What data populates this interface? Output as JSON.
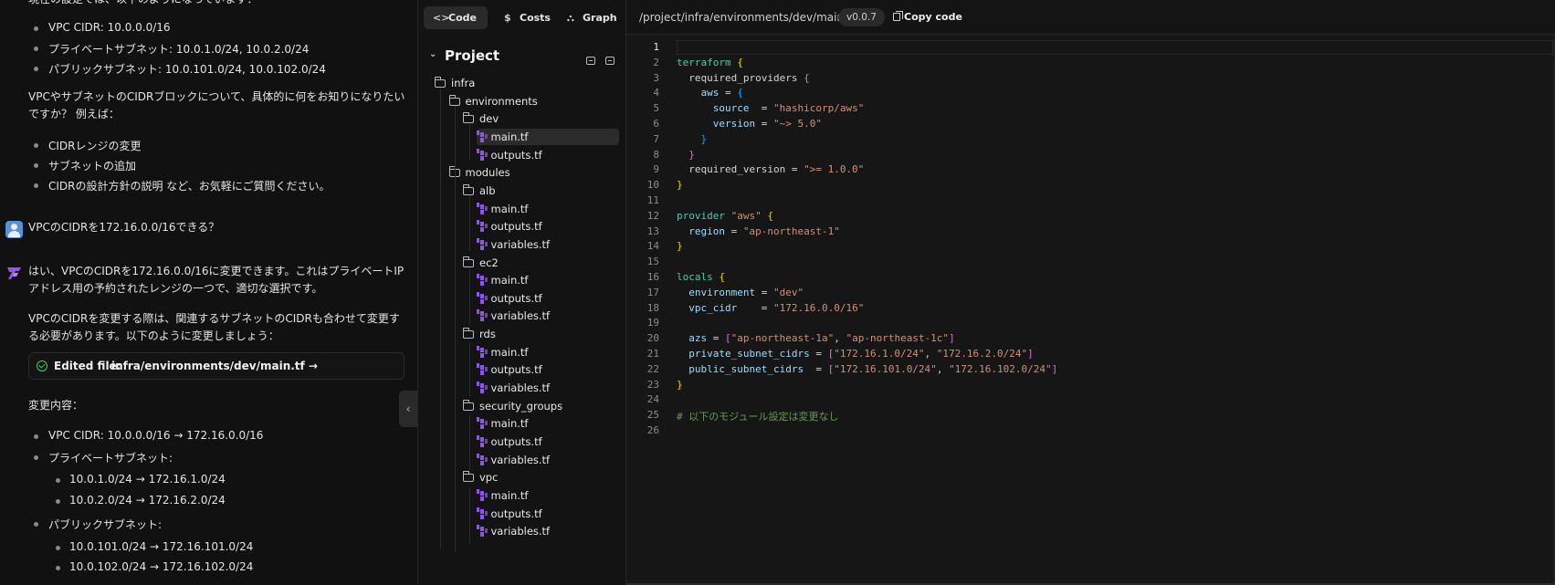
{
  "chat": {
    "top_cut_text": "現在の設定では、以下のようになっています：",
    "current": [
      "VPC CIDR: 10.0.0.0/16",
      "プライベートサブネット: 10.0.1.0/24, 10.0.2.0/24",
      "パブリックサブネット: 10.0.101.0/24, 10.0.102.0/24"
    ],
    "question": "VPCやサブネットのCIDRブロックについて、具体的に何をお知りになりたいですか？ 例えば：",
    "options": [
      "CIDRレンジの変更",
      "サブネットの追加",
      "CIDRの設計方針の説明 など、お気軽にご質問ください。"
    ],
    "user_message": "VPCのCIDRを172.16.0.0/16できる？",
    "ai_reply_1": "はい、VPCのCIDRを172.16.0.0/16に変更できます。これはプライベートIPアドレス用の予約されたレンジの一つで、適切な選択です。",
    "ai_reply_2": "VPCのCIDRを変更する際は、関連するサブネットのCIDRも合わせて変更する必要があります。以下のように変更しましょう：",
    "edited_label": "Edited file:",
    "edited_path": "infra/environments/dev/main.tf →",
    "changes_title": "変更内容：",
    "change_vpc": "VPC CIDR: 10.0.0.0/16 → 172.16.0.0/16",
    "change_private_title": "プライベートサブネット:",
    "change_private": [
      "10.0.1.0/24 → 172.16.1.0/24",
      "10.0.2.0/24 → 172.16.2.0/24"
    ],
    "change_public_title": "パブリックサブネット:",
    "change_public": [
      "10.0.101.0/24 → 172.16.101.0/24",
      "10.0.102.0/24 → 172.16.102.0/24"
    ],
    "collapse_glyph": "‹"
  },
  "toolbar": {
    "code_label": "Code",
    "costs_label": "Costs",
    "graph_label": "Graph",
    "code_icon": "<>",
    "costs_icon": "$",
    "graph_icon": "⛬"
  },
  "project": {
    "title": "Project",
    "chevron": "⌄",
    "tree": [
      {
        "label": "infra",
        "type": "folder",
        "depth": 0
      },
      {
        "label": "environments",
        "type": "folder",
        "depth": 1
      },
      {
        "label": "dev",
        "type": "folder",
        "depth": 2
      },
      {
        "label": "main.tf",
        "type": "file",
        "depth": 3,
        "selected": true
      },
      {
        "label": "outputs.tf",
        "type": "file",
        "depth": 3
      },
      {
        "label": "modules",
        "type": "folder",
        "depth": 1
      },
      {
        "label": "alb",
        "type": "folder",
        "depth": 2
      },
      {
        "label": "main.tf",
        "type": "file",
        "depth": 3
      },
      {
        "label": "outputs.tf",
        "type": "file",
        "depth": 3
      },
      {
        "label": "variables.tf",
        "type": "file",
        "depth": 3
      },
      {
        "label": "ec2",
        "type": "folder",
        "depth": 2
      },
      {
        "label": "main.tf",
        "type": "file",
        "depth": 3
      },
      {
        "label": "outputs.tf",
        "type": "file",
        "depth": 3
      },
      {
        "label": "variables.tf",
        "type": "file",
        "depth": 3
      },
      {
        "label": "rds",
        "type": "folder",
        "depth": 2
      },
      {
        "label": "main.tf",
        "type": "file",
        "depth": 3
      },
      {
        "label": "outputs.tf",
        "type": "file",
        "depth": 3
      },
      {
        "label": "variables.tf",
        "type": "file",
        "depth": 3
      },
      {
        "label": "security_groups",
        "type": "folder",
        "depth": 2
      },
      {
        "label": "main.tf",
        "type": "file",
        "depth": 3
      },
      {
        "label": "outputs.tf",
        "type": "file",
        "depth": 3
      },
      {
        "label": "variables.tf",
        "type": "file",
        "depth": 3
      },
      {
        "label": "vpc",
        "type": "folder",
        "depth": 2
      },
      {
        "label": "main.tf",
        "type": "file",
        "depth": 3
      },
      {
        "label": "outputs.tf",
        "type": "file",
        "depth": 3
      },
      {
        "label": "variables.tf",
        "type": "file",
        "depth": 3
      }
    ]
  },
  "editor": {
    "path": "/project/infra/environments/dev/main.tf",
    "version": "v0.0.7",
    "copy_label": "Copy code",
    "current_line": 1,
    "lines": [
      [],
      [
        [
          "k",
          "terraform"
        ],
        [
          "p",
          " "
        ],
        [
          "b1",
          "{"
        ]
      ],
      [
        [
          "p",
          "  required_providers "
        ],
        [
          "b2",
          "{"
        ]
      ],
      [
        [
          "p",
          "    "
        ],
        [
          "attr",
          "aws"
        ],
        [
          "p",
          " = "
        ],
        [
          "b3",
          "{"
        ]
      ],
      [
        [
          "p",
          "      "
        ],
        [
          "attr",
          "source"
        ],
        [
          "p",
          "  = "
        ],
        [
          "s",
          "\"hashicorp/aws\""
        ]
      ],
      [
        [
          "p",
          "      "
        ],
        [
          "attr",
          "version"
        ],
        [
          "p",
          " = "
        ],
        [
          "s",
          "\"~> 5.0\""
        ]
      ],
      [
        [
          "p",
          "    "
        ],
        [
          "b3",
          "}"
        ]
      ],
      [
        [
          "p",
          "  "
        ],
        [
          "b2",
          "}"
        ]
      ],
      [
        [
          "p",
          "  required_version = "
        ],
        [
          "s",
          "\">= 1.0.0\""
        ]
      ],
      [
        [
          "b1",
          "}"
        ]
      ],
      [],
      [
        [
          "k",
          "provider"
        ],
        [
          "p",
          " "
        ],
        [
          "s",
          "\"aws\""
        ],
        [
          "p",
          " "
        ],
        [
          "b1",
          "{"
        ]
      ],
      [
        [
          "p",
          "  "
        ],
        [
          "attr",
          "region"
        ],
        [
          "p",
          " = "
        ],
        [
          "s",
          "\"ap-northeast-1\""
        ]
      ],
      [
        [
          "b1",
          "}"
        ]
      ],
      [],
      [
        [
          "k",
          "locals"
        ],
        [
          "p",
          " "
        ],
        [
          "b1",
          "{"
        ]
      ],
      [
        [
          "p",
          "  "
        ],
        [
          "attr",
          "environment"
        ],
        [
          "p",
          " = "
        ],
        [
          "s",
          "\"dev\""
        ]
      ],
      [
        [
          "p",
          "  "
        ],
        [
          "attr",
          "vpc_cidr"
        ],
        [
          "p",
          "    = "
        ],
        [
          "s",
          "\"172.16.0.0/16\""
        ]
      ],
      [],
      [
        [
          "p",
          "  "
        ],
        [
          "attr",
          "azs"
        ],
        [
          "p",
          " = "
        ],
        [
          "b2",
          "["
        ],
        [
          "s",
          "\"ap-northeast-1a\""
        ],
        [
          "p",
          ", "
        ],
        [
          "s",
          "\"ap-northeast-1c\""
        ],
        [
          "b2",
          "]"
        ]
      ],
      [
        [
          "p",
          "  "
        ],
        [
          "attr",
          "private_subnet_cidrs"
        ],
        [
          "p",
          " = "
        ],
        [
          "b2",
          "["
        ],
        [
          "s",
          "\"172.16.1.0/24\""
        ],
        [
          "p",
          ", "
        ],
        [
          "s",
          "\"172.16.2.0/24\""
        ],
        [
          "b2",
          "]"
        ]
      ],
      [
        [
          "p",
          "  "
        ],
        [
          "attr",
          "public_subnet_cidrs"
        ],
        [
          "p",
          "  = "
        ],
        [
          "b2",
          "["
        ],
        [
          "s",
          "\"172.16.101.0/24\""
        ],
        [
          "p",
          ", "
        ],
        [
          "s",
          "\"172.16.102.0/24\""
        ],
        [
          "b2",
          "]"
        ]
      ],
      [
        [
          "b1",
          "}"
        ]
      ],
      [],
      [
        [
          "cm",
          "# 以下のモジュール設定は変更なし"
        ]
      ],
      []
    ]
  }
}
